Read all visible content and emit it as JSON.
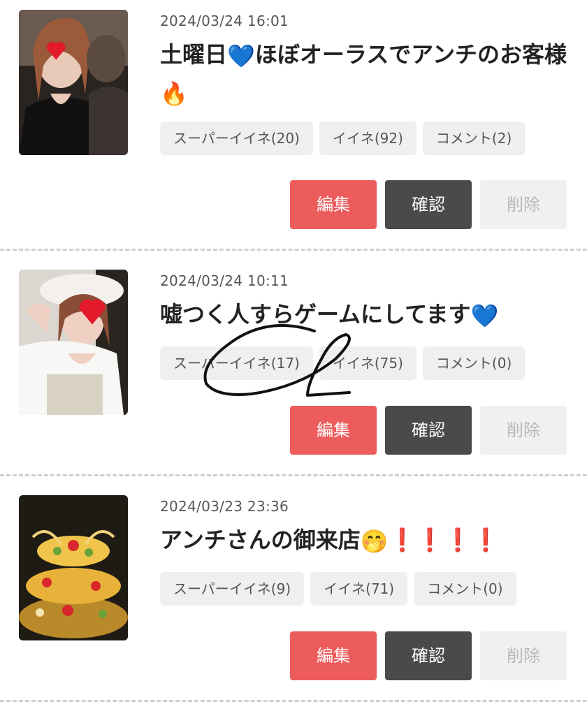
{
  "posts": [
    {
      "date": "2024/03/24 16:01",
      "title": "土曜日",
      "title_emoji1": "💙",
      "title_rest": "ほぼオーラスでアンチのお客様",
      "title_emoji2": "🔥",
      "super_like": "スーパーイイネ(20)",
      "like": "イイネ(92)",
      "comment": "コメント(2)"
    },
    {
      "date": "2024/03/24 10:11",
      "title": "嘘つく人すらゲームにしてます",
      "title_emoji1": "💙",
      "super_like": "スーパーイイネ(17)",
      "like": "イイネ(75)",
      "comment": "コメント(0)"
    },
    {
      "date": "2024/03/23 23:36",
      "title": "アンチさんの御来店",
      "title_emoji1": "🤭",
      "title_rest": "❗❗❗❗",
      "super_like": "スーパーイイネ(9)",
      "like": "イイネ(71)",
      "comment": "コメント(0)"
    }
  ],
  "buttons": {
    "edit": "編集",
    "view": "確認",
    "delete": "削除"
  },
  "colors": {
    "edit": "#ed5c5c",
    "view": "#4a4a4a",
    "delete_bg": "#f0f0f0",
    "chip_bg": "#efefef"
  }
}
